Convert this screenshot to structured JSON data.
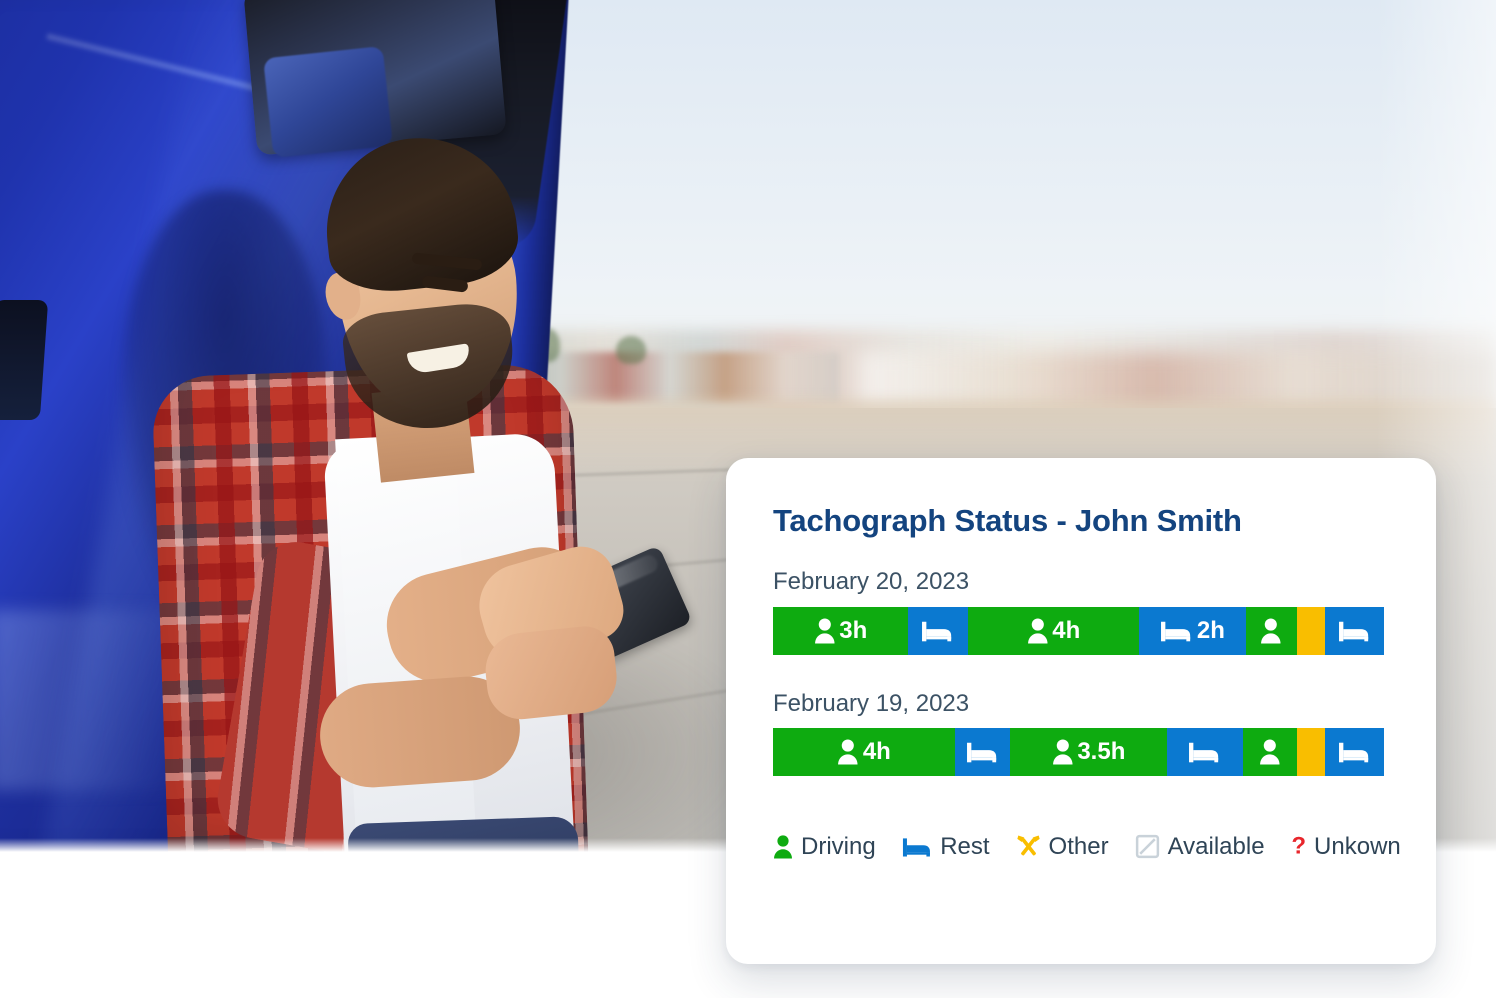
{
  "photo": {
    "alt_description": "Smiling truck driver in a plaid shirt standing beside a blue truck cab using a smartphone",
    "subjects": [
      "truck-driver",
      "blue-truck-cab",
      "smartphone"
    ]
  },
  "card": {
    "title": "Tachograph Status - John Smith",
    "accent_color": "#14447f",
    "days": [
      {
        "date_label": "February 20, 2023",
        "segments": [
          {
            "status": "driving",
            "icon": "driver-icon",
            "label": "3h",
            "color": "#0EAB10",
            "width_pct": 22.1
          },
          {
            "status": "rest",
            "icon": "bed-icon",
            "label": "",
            "color": "#0B79D0",
            "width_pct": 9.8
          },
          {
            "status": "driving",
            "icon": "driver-icon",
            "label": "4h",
            "color": "#0EAB10",
            "width_pct": 28.0
          },
          {
            "status": "rest",
            "icon": "bed-icon",
            "label": "2h",
            "color": "#0B79D0",
            "width_pct": 17.5
          },
          {
            "status": "driving",
            "icon": "driver-icon",
            "label": "",
            "color": "#0EAB10",
            "width_pct": 8.3
          },
          {
            "status": "other",
            "icon": "",
            "label": "",
            "color": "#F9BE00",
            "width_pct": 4.6
          },
          {
            "status": "rest",
            "icon": "bed-icon",
            "label": "",
            "color": "#0B79D0",
            "width_pct": 9.7
          }
        ]
      },
      {
        "date_label": "February 19, 2023",
        "segments": [
          {
            "status": "driving",
            "icon": "driver-icon",
            "label": "4h",
            "color": "#0EAB10",
            "width_pct": 29.8
          },
          {
            "status": "rest",
            "icon": "bed-icon",
            "label": "",
            "color": "#0B79D0",
            "width_pct": 9.0
          },
          {
            "status": "driving",
            "icon": "driver-icon",
            "label": "3.5h",
            "color": "#0EAB10",
            "width_pct": 25.7
          },
          {
            "status": "rest",
            "icon": "bed-icon",
            "label": "",
            "color": "#0B79D0",
            "width_pct": 12.4
          },
          {
            "status": "driving",
            "icon": "driver-icon",
            "label": "",
            "color": "#0EAB10",
            "width_pct": 8.8
          },
          {
            "status": "other",
            "icon": "",
            "label": "",
            "color": "#F9BE00",
            "width_pct": 4.6
          },
          {
            "status": "rest",
            "icon": "bed-icon",
            "label": "",
            "color": "#0B79D0",
            "width_pct": 9.7
          }
        ]
      }
    ],
    "legend": [
      {
        "label": "Driving",
        "icon": "driver-icon",
        "color": "#0EAB10"
      },
      {
        "label": "Rest",
        "icon": "bed-icon",
        "color": "#0B79D0"
      },
      {
        "label": "Other",
        "icon": "hammers-icon",
        "color": "#F9BE00"
      },
      {
        "label": "Available",
        "icon": "slash-box-icon",
        "color": "#C9D2D9"
      },
      {
        "label": "Unkown",
        "icon": "question-icon",
        "color": "#E8262C"
      }
    ]
  }
}
